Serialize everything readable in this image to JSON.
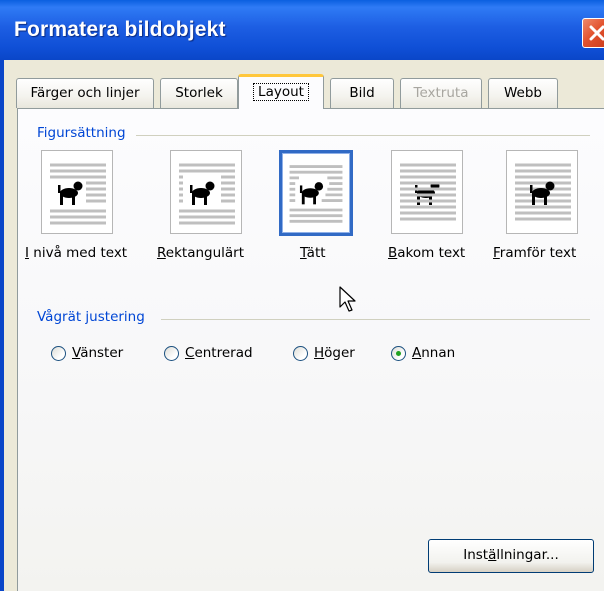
{
  "window": {
    "title": "Formatera bildobjekt"
  },
  "tabs": [
    {
      "label": "Färger och linjer",
      "state": "normal"
    },
    {
      "label": "Storlek",
      "state": "normal"
    },
    {
      "label": "Layout",
      "state": "active"
    },
    {
      "label": "Bild",
      "state": "normal"
    },
    {
      "label": "Textruta",
      "state": "disabled"
    },
    {
      "label": "Webb",
      "state": "normal"
    }
  ],
  "wrapping": {
    "group_title": "Figursättning",
    "options": [
      {
        "label_pre": "",
        "label_key": "I",
        "label_post": " nivå med text",
        "selected": false,
        "icon": "inline-with-text-icon"
      },
      {
        "label_pre": "",
        "label_key": "R",
        "label_post": "ektangulärt",
        "selected": false,
        "icon": "square-wrap-icon"
      },
      {
        "label_pre": "",
        "label_key": "T",
        "label_post": "ätt",
        "selected": true,
        "icon": "tight-wrap-icon"
      },
      {
        "label_pre": "",
        "label_key": "B",
        "label_post": "akom text",
        "selected": false,
        "icon": "behind-text-icon"
      },
      {
        "label_pre": "",
        "label_key": "F",
        "label_post": "ramför text",
        "selected": false,
        "icon": "in-front-of-text-icon"
      }
    ]
  },
  "alignment": {
    "group_title": "Vågrät justering",
    "options": [
      {
        "label_pre": "",
        "label_key": "V",
        "label_post": "änster",
        "checked": false
      },
      {
        "label_pre": "",
        "label_key": "C",
        "label_post": "entrerad",
        "checked": false
      },
      {
        "label_pre": "",
        "label_key": "H",
        "label_post": "öger",
        "checked": false
      },
      {
        "label_pre": "",
        "label_key": "A",
        "label_post": "nnan",
        "checked": true
      }
    ]
  },
  "buttons": {
    "settings_pre": "Inst",
    "settings_key": "ä",
    "settings_post": "llningar..."
  },
  "colors": {
    "titlebar": "#0f4fd6",
    "accent": "#316ac5",
    "group_title": "#0046d5",
    "radio_dot": "#21a121",
    "close_button": "#e2522e"
  }
}
